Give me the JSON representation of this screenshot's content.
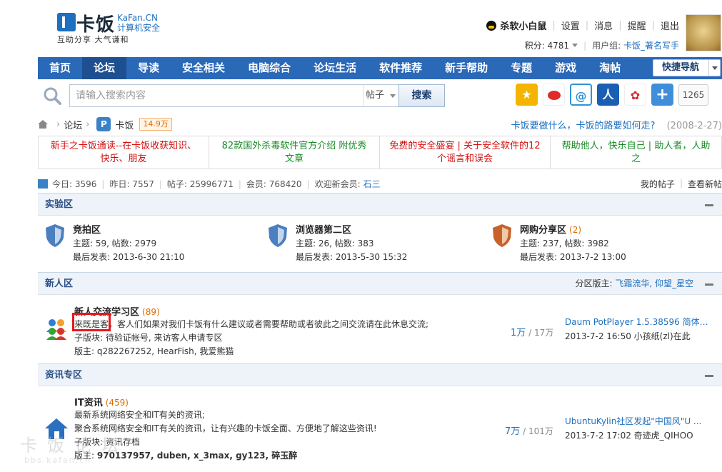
{
  "header": {
    "logo_text": "卡饭",
    "logo_en": "KaFan.CN",
    "logo_en2": "计算机安全",
    "logo_sub": "互助分享    大气谦和",
    "user_name": "杀软小白鼠",
    "links": [
      "设置",
      "消息",
      "提醒",
      "退出"
    ],
    "points_label": "积分: 4781",
    "group_label": "用户组:",
    "group_value": "卡饭_著名写手"
  },
  "nav": {
    "items": [
      "首页",
      "论坛",
      "导读",
      "安全相关",
      "电脑综合",
      "论坛生活",
      "软件推荐",
      "新手帮助",
      "专题",
      "游戏",
      "淘帖"
    ],
    "active_index": 1,
    "quick_nav": "快捷导航"
  },
  "search": {
    "placeholder": "请输入搜索内容",
    "type": "帖子",
    "button": "搜索",
    "share_count": "1265"
  },
  "breadcrumb": {
    "item1": "论坛",
    "item2": "卡饭",
    "badge": "P",
    "count": "14.9万"
  },
  "topline": {
    "text": "卡饭要做什么，卡饭的路要如何走?",
    "date": "(2008-2-27)"
  },
  "announcements": [
    {
      "text": "新手之卡饭通读--在卡饭收获知识、快乐、朋友",
      "color": "red"
    },
    {
      "text": "82款国外杀毒软件官方介绍 附优秀文章",
      "color": "green"
    },
    {
      "text": "免费的安全盛宴 | 关于安全软件的12个谣言和误会",
      "color": "red"
    },
    {
      "text": "帮助他人，快乐自己 | 助人者，人助之",
      "color": "green"
    }
  ],
  "stats": {
    "today": "今日: 3596",
    "yesterday": "昨日: 7557",
    "posts": "帖子: 25996771",
    "members": "会员: 768420",
    "welcome": "欢迎新会员:",
    "new_member": "石三",
    "my_posts": "我的帖子",
    "new_posts": "查看新帖"
  },
  "sections": {
    "lab": {
      "title": "实验区",
      "forums": [
        {
          "name": "竞拍区",
          "count": "",
          "topics": "主题: 59, 帖数: 2979",
          "last": "最后发表: 2013-6-30 21:10"
        },
        {
          "name": "浏览器第二区",
          "count": "",
          "topics": "主题: 26, 帖数: 383",
          "last": "最后发表: 2013-5-30 15:32"
        },
        {
          "name": "网购分享区",
          "count": "(2)",
          "topics": "主题: 237, 帖数: 3982",
          "last": "最后发表: 2013-7-2 13:00"
        }
      ]
    },
    "newbie": {
      "title": "新人区",
      "mods_label": "分区版主:",
      "mods": "飞霜流华, 仰望_星空",
      "forum": {
        "name": "新人交流学习区",
        "count": "(89)",
        "desc": "来既是客，客人们如果对我们卡饭有什么建议或者需要帮助或者彼此之间交流请在此休息交流;",
        "sub": "子版块: 待验证帐号, 来访客人申请专区",
        "owner_label": "版主:",
        "owners": "q282267252, HearFish, 我爱熊猫",
        "stat_a": "1万",
        "stat_b": "17万",
        "last_title": "Daum PotPlayer 1.5.38596 简体中 ...",
        "last_info": "2013-7-2 16:50 小孩纸(zl)在此"
      }
    },
    "news": {
      "title": "资讯专区",
      "forum": {
        "name": "IT资讯",
        "count": "(459)",
        "desc1": "最新系统网络安全和IT有关的资讯;",
        "desc2": "聚合系统网络安全和IT有关的资讯，让有兴趣的卡饭全面、方便地了解这些资讯!",
        "sub": "子版块: 资讯存档",
        "owner_label": "版主:",
        "owners": "970137957, duben, x_3max, gy123, 碎玉醉",
        "stat_a": "7万",
        "stat_b": "101万",
        "last_title": "UbuntuKylin社区发起\"中国风\"U ...",
        "last_info": "2013-7-2 17:02 奇迹虎_QIHOO"
      }
    }
  },
  "watermark": {
    "main": "卡饭论坛",
    "url": "bbs.kafan.cn"
  },
  "colors": {
    "nav_bg": "#2a68b8",
    "nav_active": "#1e4f90",
    "link": "#1d6fbf",
    "highlight": "#e5171c"
  }
}
